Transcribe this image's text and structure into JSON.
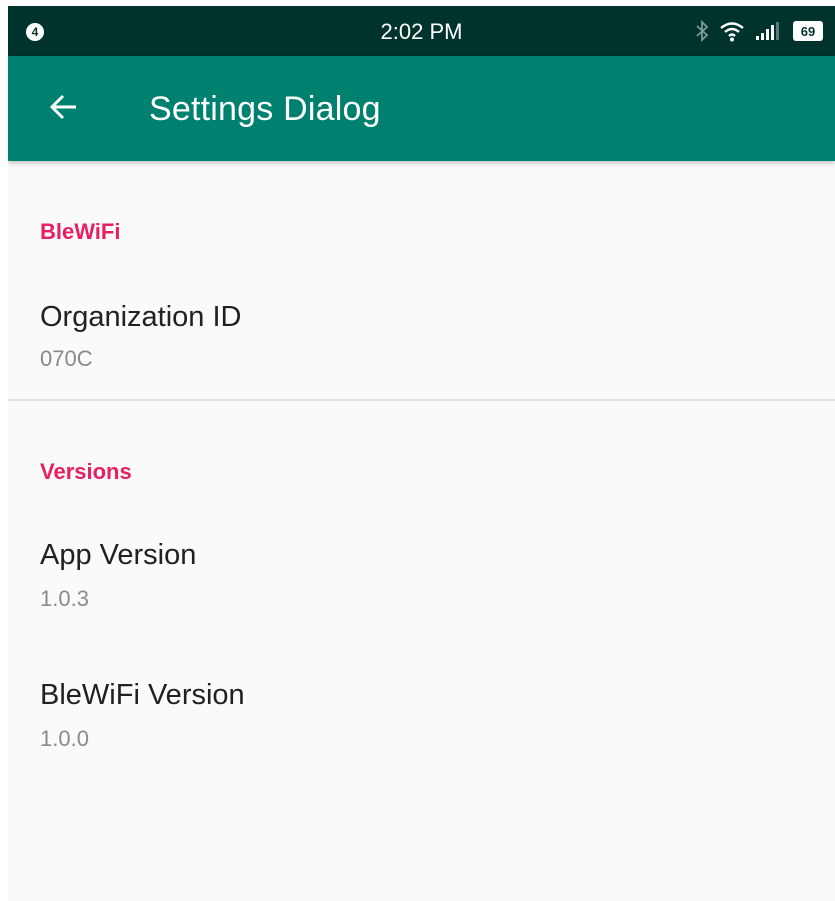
{
  "status_bar": {
    "notification_count": "4",
    "time": "2:02 PM",
    "battery_level": "69",
    "icons": [
      "bluetooth-icon",
      "wifi-icon",
      "signal-icon",
      "battery-icon"
    ]
  },
  "toolbar": {
    "back_icon": "arrow-back-icon",
    "title": "Settings Dialog"
  },
  "sections": {
    "blewifi": {
      "header": "BleWiFi",
      "organization_id": {
        "title": "Organization ID",
        "summary": "070C"
      }
    },
    "versions": {
      "header": "Versions",
      "app_version": {
        "title": "App Version",
        "summary": "1.0.3"
      },
      "blewifi_version": {
        "title": "BleWiFi Version",
        "summary": "1.0.0"
      }
    }
  },
  "colors": {
    "status_bar": "#00332c",
    "toolbar": "#00806f",
    "accent": "#e91e63",
    "background": "#fafafa"
  }
}
